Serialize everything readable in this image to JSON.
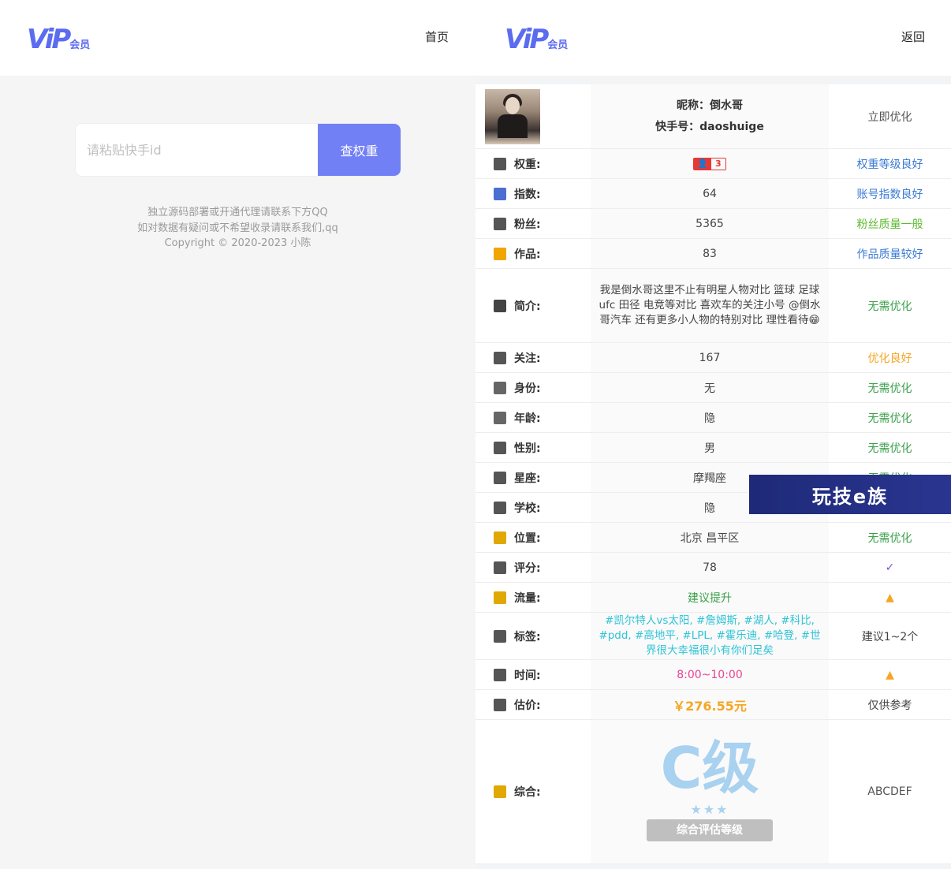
{
  "left": {
    "logo_big": "ViP",
    "logo_small": "会员",
    "nav_home": "首页",
    "search_placeholder": "请粘贴快手id",
    "search_button": "查权重",
    "footer_line1": "独立源码部署或开通代理请联系下方QQ",
    "footer_line2": "如对数据有疑问或不希望收录请联系我们,qq",
    "footer_line3": "Copyright © 2020-2023 小陈"
  },
  "right": {
    "logo_big": "ViP",
    "logo_small": "会员",
    "nav_back": "返回",
    "profile": {
      "nickname": "昵称：倒水哥",
      "account": "快手号：daoshuige",
      "action": "立即优化"
    },
    "rows": [
      {
        "label": "权重:",
        "value": "",
        "note": "权重等级良好",
        "icon_color": "#555",
        "value_color": "#444",
        "note_color": "#3a7bd5"
      },
      {
        "label": "指数:",
        "value": "64",
        "note": "账号指数良好",
        "icon_color": "#4a6fd1",
        "value_color": "#444",
        "note_color": "#3a7bd5"
      },
      {
        "label": "粉丝:",
        "value": "5365",
        "note": "粉丝质量一般",
        "icon_color": "#555",
        "value_color": "#444",
        "note_color": "#5cbb2e"
      },
      {
        "label": "作品:",
        "value": "83",
        "note": "作品质量较好",
        "icon_color": "#f0a500",
        "value_color": "#444",
        "note_color": "#3a7bd5"
      },
      {
        "label": "简介:",
        "value": "我是倒水哥这里不止有明星人物对比 篮球 足球 ufc 田径 电竞等对比 喜欢车的关注小号 @倒水哥汽车 还有更多小人物的特别对比 理性看待😁",
        "note": "无需优化",
        "icon_color": "#444",
        "value_color": "#444",
        "note_color": "#3aa04a"
      },
      {
        "label": "关注:",
        "value": "167",
        "note": "优化良好",
        "icon_color": "#555",
        "value_color": "#444",
        "note_color": "#f5a623"
      },
      {
        "label": "身份:",
        "value": "无",
        "note": "无需优化",
        "icon_color": "#666",
        "value_color": "#444",
        "note_color": "#3aa04a"
      },
      {
        "label": "年龄:",
        "value": "隐",
        "note": "无需优化",
        "icon_color": "#666",
        "value_color": "#444",
        "note_color": "#3aa04a"
      },
      {
        "label": "性别:",
        "value": "男",
        "note": "无需优化",
        "icon_color": "#555",
        "value_color": "#444",
        "note_color": "#3aa04a"
      },
      {
        "label": "星座:",
        "value": "摩羯座",
        "note": "无需优化",
        "icon_color": "#555",
        "value_color": "#444",
        "note_color": "#3aa04a"
      },
      {
        "label": "学校:",
        "value": "隐",
        "note": "",
        "icon_color": "#555",
        "value_color": "#444",
        "note_color": "#3aa04a"
      },
      {
        "label": "位置:",
        "value": "北京 昌平区",
        "note": "无需优化",
        "icon_color": "#e0a800",
        "value_color": "#444",
        "note_color": "#3aa04a"
      },
      {
        "label": "评分:",
        "value": "78",
        "note": "✓",
        "icon_color": "#555",
        "value_color": "#444",
        "note_color": "#7b4fc8"
      },
      {
        "label": "流量:",
        "value": "建议提升",
        "note": "▲",
        "icon_color": "#e0a800",
        "value_color": "#3aa04a",
        "note_color": "#f5a623"
      },
      {
        "label": "标签:",
        "value": "#凯尔特人vs太阳, #詹姆斯, #湖人, #科比, #pdd, #高地平, #LPL, #霍乐迪, #哈登, #世界很大幸福很小有你们足矣",
        "note": "建议1~2个",
        "icon_color": "#555",
        "value_color": "#2ec4d6",
        "note_color": "#444"
      },
      {
        "label": "时间:",
        "value": "8:00~10:00",
        "note": "▲",
        "icon_color": "#555",
        "value_color": "#e84393",
        "note_color": "#f5a623"
      },
      {
        "label": "估价:",
        "value": "￥276.55元",
        "note": "仅供参考",
        "icon_color": "#555",
        "value_color": "#f5a623",
        "note_color": "#444"
      }
    ],
    "weight_badge": {
      "left": "👤",
      "right": "3"
    },
    "overall": {
      "label": "综合:",
      "grade": "C级",
      "stars": "★★★",
      "ribbon": "综合评估等级",
      "note": "ABCDEF"
    },
    "watermark": "玩技e族"
  }
}
